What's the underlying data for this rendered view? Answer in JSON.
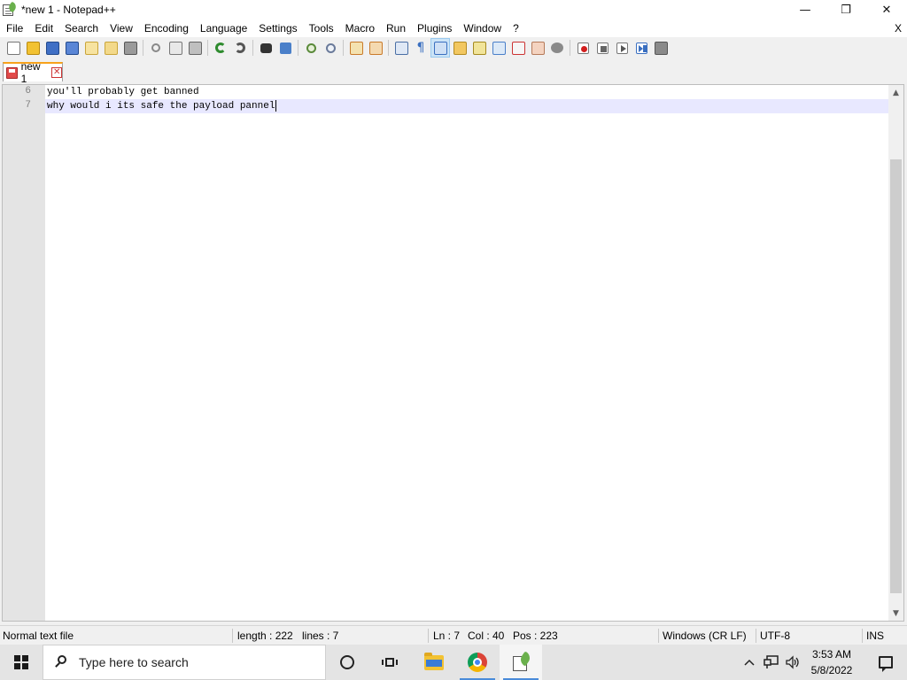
{
  "window": {
    "title": "*new 1 - Notepad++",
    "controls": {
      "minimize": "—",
      "maximize": "❐",
      "close": "✕"
    }
  },
  "menu": {
    "items": [
      "File",
      "Edit",
      "Search",
      "View",
      "Encoding",
      "Language",
      "Settings",
      "Tools",
      "Macro",
      "Run",
      "Plugins",
      "Window",
      "?"
    ],
    "close_doc": "X"
  },
  "toolbar": {
    "icons": [
      "new-file-icon",
      "open-file-icon",
      "save-icon",
      "save-all-icon",
      "close-icon",
      "close-all-icon",
      "print-icon",
      "cut-icon",
      "copy-icon",
      "paste-icon",
      "undo-icon",
      "redo-icon",
      "find-icon",
      "replace-icon",
      "zoom-in-icon",
      "zoom-out-icon",
      "sync-vertical-icon",
      "sync-horizontal-icon",
      "word-wrap-icon",
      "show-all-chars-icon",
      "indent-guide-icon",
      "udl-icon",
      "doc-map-icon",
      "function-list-icon",
      "doc-switcher-icon",
      "folder-workspace-icon",
      "monitoring-icon",
      "record-macro-icon",
      "stop-record-icon",
      "playback-icon",
      "run-macro-multiple-icon",
      "save-macro-icon"
    ]
  },
  "tabs": [
    {
      "label": "new 1",
      "close": "✕"
    }
  ],
  "editor": {
    "lines": [
      {
        "number": "6",
        "text": "you'll probably get banned"
      },
      {
        "number": "7",
        "text": "why would i its safe the payload pannel"
      }
    ],
    "current_line": 7
  },
  "scrollbar": {
    "up": "▲",
    "down": "▼"
  },
  "status": {
    "file_type": "Normal text file",
    "length": "length : 222",
    "lines": "lines : 7",
    "ln": "Ln : 7",
    "col": "Col : 40",
    "pos": "Pos : 223",
    "eol": "Windows (CR LF)",
    "encoding": "UTF-8",
    "mode": "INS"
  },
  "taskbar": {
    "search_placeholder": "Type here to search",
    "time": "3:53 AM",
    "date": "5/8/2022",
    "accent": "#4a8bd9"
  }
}
